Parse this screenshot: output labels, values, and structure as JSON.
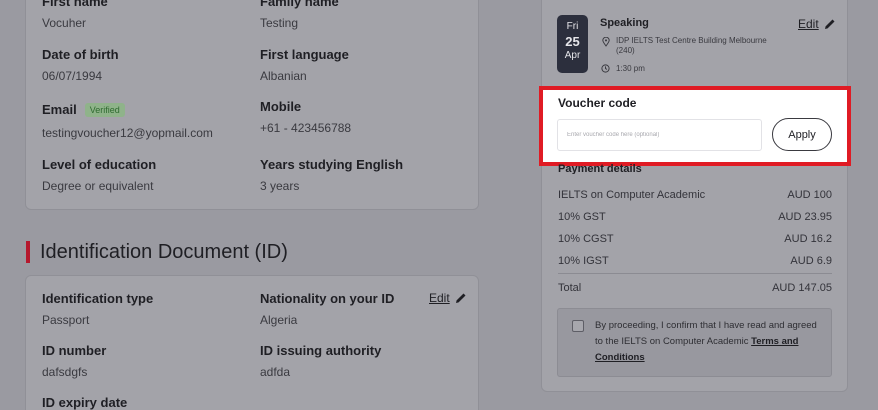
{
  "personal": {
    "first_name_label": "First name",
    "first_name_value": "Vocuher",
    "family_name_label": "Family name",
    "family_name_value": "Testing",
    "dob_label": "Date of birth",
    "dob_value": "06/07/1994",
    "first_language_label": "First language",
    "first_language_value": "Albanian",
    "email_label": "Email",
    "email_badge": "Verified",
    "email_value": "testingvoucher12@yopmail.com",
    "mobile_label": "Mobile",
    "mobile_value": "+61 - 423456788",
    "education_label": "Level of education",
    "education_value": "Degree or equivalent",
    "years_label": "Years studying English",
    "years_value": "3 years"
  },
  "identification": {
    "section_title": "Identification Document (ID)",
    "edit_label": "Edit",
    "id_type_label": "Identification type",
    "id_type_value": "Passport",
    "nationality_label": "Nationality on your ID",
    "nationality_value": "Algeria",
    "id_number_label": "ID number",
    "id_number_value": "dafsdgfs",
    "authority_label": "ID issuing authority",
    "authority_value": "adfda",
    "expiry_label": "ID expiry date"
  },
  "speaking": {
    "dow": "Fri",
    "day": "25",
    "month": "Apr",
    "title": "Speaking",
    "edit_label": "Edit",
    "location": "IDP IELTS Test Centre Building Melbourne (240)",
    "time": "1:30 pm"
  },
  "voucher": {
    "title": "Voucher code",
    "placeholder": "Enter voucher code here (optional)",
    "apply_label": "Apply"
  },
  "payment": {
    "title": "Payment details",
    "rows": [
      {
        "label": "IELTS on Computer Academic",
        "value": "AUD 100"
      },
      {
        "label": "10% GST",
        "value": "AUD 23.95"
      },
      {
        "label": "10% CGST",
        "value": "AUD 16.2"
      },
      {
        "label": "10% IGST",
        "value": "AUD 6.9"
      }
    ],
    "total_label": "Total",
    "total_value": "AUD 147.05"
  },
  "consent": {
    "text_prefix": "By proceeding, I confirm that I have read and agreed to the IELTS on Computer Academic ",
    "link_label": "Terms and Conditions"
  },
  "colors": {
    "highlight": "#e01b24",
    "accent_bar": "#b5182d"
  }
}
